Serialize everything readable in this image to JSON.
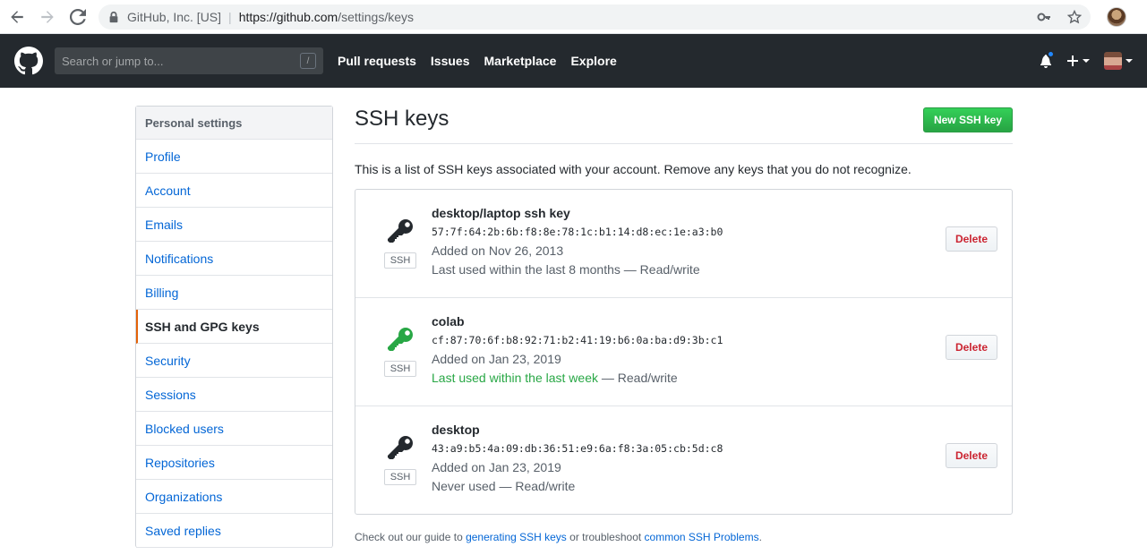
{
  "browser": {
    "site_owner": "GitHub, Inc. [US]",
    "url_host": "https://github.com",
    "url_path": "/settings/keys"
  },
  "header": {
    "search_placeholder": "Search or jump to...",
    "search_shortcut": "/",
    "nav": [
      "Pull requests",
      "Issues",
      "Marketplace",
      "Explore"
    ],
    "plus_label": "+"
  },
  "sidebar": {
    "heading": "Personal settings",
    "items": [
      {
        "label": "Profile"
      },
      {
        "label": "Account"
      },
      {
        "label": "Emails"
      },
      {
        "label": "Notifications"
      },
      {
        "label": "Billing"
      },
      {
        "label": "SSH and GPG keys"
      },
      {
        "label": "Security"
      },
      {
        "label": "Sessions"
      },
      {
        "label": "Blocked users"
      },
      {
        "label": "Repositories"
      },
      {
        "label": "Organizations"
      },
      {
        "label": "Saved replies"
      }
    ],
    "selected": "SSH and GPG keys"
  },
  "main": {
    "title": "SSH keys",
    "new_key_button": "New SSH key",
    "lead": "This is a list of SSH keys associated with your account. Remove any keys that you do not recognize.",
    "keys": [
      {
        "name": "desktop/laptop ssh key",
        "fingerprint": "57:7f:64:2b:6b:f8:8e:78:1c:b1:14:d8:ec:1e:a3:b0",
        "added": "Added on Nov 26, 2013",
        "last_used": "Last used within the last 8 months",
        "access": " — Read/write",
        "badge": "SSH",
        "delete_label": "Delete",
        "icon_color": "#24292e"
      },
      {
        "name": "colab",
        "fingerprint": "cf:87:70:6f:b8:92:71:b2:41:19:b6:0a:ba:d9:3b:c1",
        "added": "Added on Jan 23, 2019",
        "last_used": "Last used within the last week",
        "access": " — Read/write",
        "badge": "SSH",
        "delete_label": "Delete",
        "icon_color": "#28a745"
      },
      {
        "name": "desktop",
        "fingerprint": "43:a9:b5:4a:09:db:36:51:e9:6a:f8:3a:05:cb:5d:c8",
        "added": "Added on Jan 23, 2019",
        "last_used": "Never used",
        "access": " — Read/write",
        "badge": "SSH",
        "delete_label": "Delete",
        "icon_color": "#24292e"
      }
    ],
    "footer": {
      "prefix": "Check out our guide to ",
      "link1": "generating SSH keys",
      "middle": " or troubleshoot ",
      "link2": "common SSH Problems",
      "suffix": "."
    }
  }
}
